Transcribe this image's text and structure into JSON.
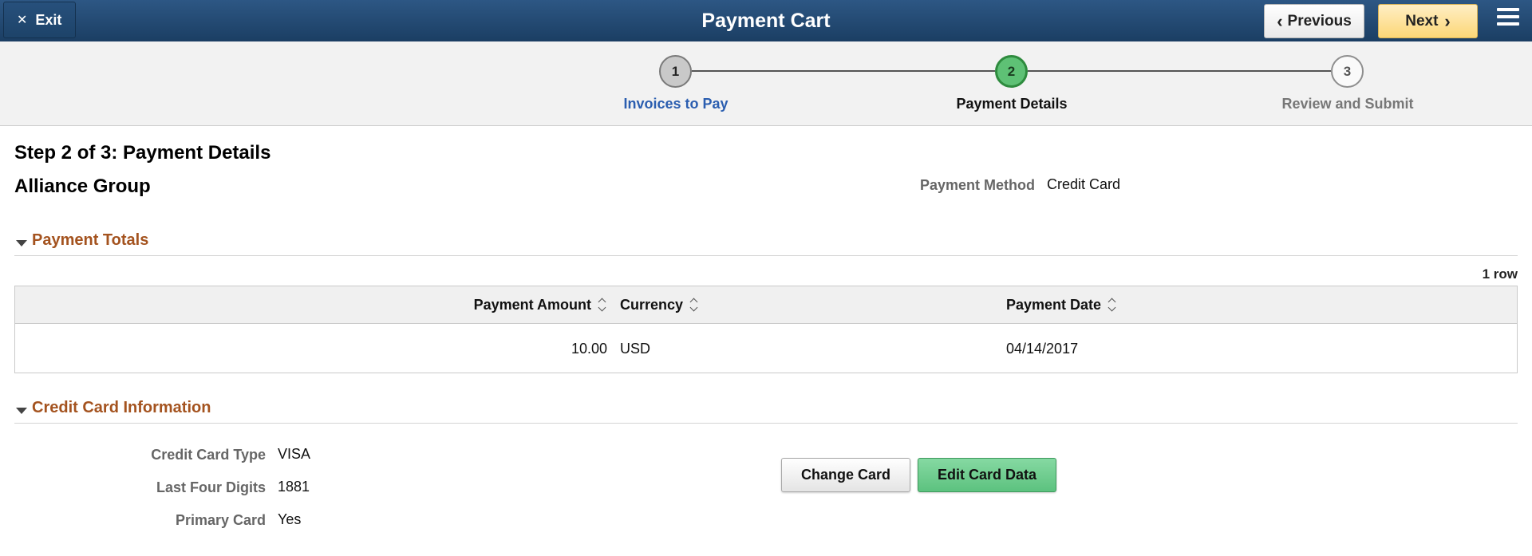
{
  "header": {
    "exit_label": "Exit",
    "title": "Payment Cart",
    "previous_label": "Previous",
    "next_label": "Next"
  },
  "train": {
    "stops": [
      {
        "number": "1",
        "label": "Invoices to Pay"
      },
      {
        "number": "2",
        "label": "Payment Details"
      },
      {
        "number": "3",
        "label": "Review and Submit"
      }
    ],
    "active_index": 1
  },
  "page": {
    "step_title": "Step 2 of 3: Payment Details",
    "company": "Alliance Group",
    "payment_method_label": "Payment Method",
    "payment_method_value": "Credit Card"
  },
  "payment_totals": {
    "section_title": "Payment Totals",
    "row_count": "1 row",
    "columns": [
      "Payment Amount",
      "Currency",
      "Payment Date"
    ],
    "rows": [
      {
        "amount": "10.00",
        "currency": "USD",
        "date": "04/14/2017"
      }
    ]
  },
  "credit_card": {
    "section_title": "Credit Card Information",
    "type_label": "Credit Card Type",
    "type_value": "VISA",
    "last_four_label": "Last Four Digits",
    "last_four_value": "1881",
    "primary_label": "Primary Card",
    "primary_value": "Yes",
    "change_label": "Change Card",
    "edit_label": "Edit Card Data"
  },
  "icons": {
    "exit": "close-icon",
    "previous": "chevron-left-icon",
    "next": "chevron-right-icon",
    "menu": "hamburger-menu-icon",
    "collapse": "triangle-down-icon",
    "sort": "sort-icon"
  },
  "colors": {
    "header": "#1f4570",
    "next_button": "#fcd777",
    "active_stop": "#5ec175",
    "section_title": "#a4531f",
    "link": "#2b5eb0",
    "edit_button": "#5cc27f"
  }
}
